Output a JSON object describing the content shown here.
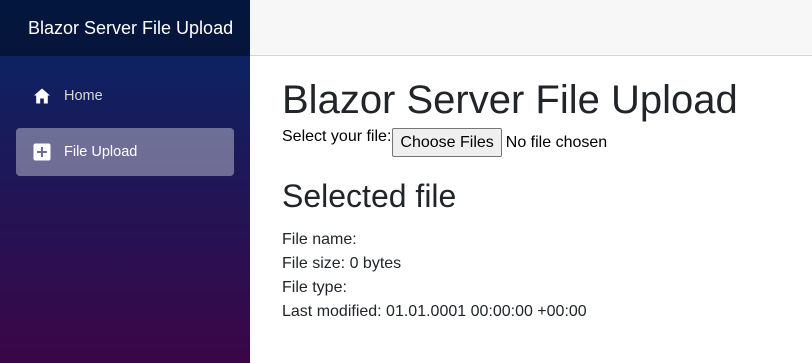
{
  "sidebar": {
    "brand": "Blazor Server File Upload",
    "items": [
      {
        "label": "Home",
        "icon": "home-icon",
        "active": false
      },
      {
        "label": "File Upload",
        "icon": "plus-icon",
        "active": true
      }
    ]
  },
  "main": {
    "title": "Blazor Server File Upload",
    "select_label": "Select your file:",
    "choose_button": "Choose Files",
    "no_file_text": "No file chosen",
    "section_title": "Selected file",
    "details": {
      "name": "File name:",
      "size": "File size: 0 bytes",
      "type": "File type:",
      "modified": "Last modified: 01.01.0001 00:00:00 +00:00"
    }
  },
  "colors": {
    "sidebar_gradient_start": "#052767",
    "sidebar_gradient_end": "#3a0647",
    "topbar_bg": "#f7f7f7"
  }
}
